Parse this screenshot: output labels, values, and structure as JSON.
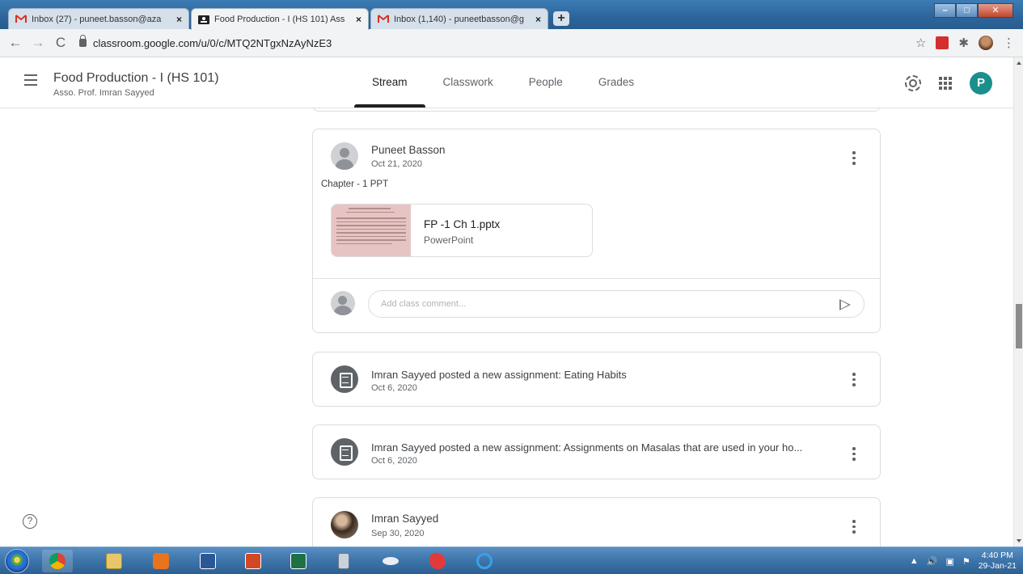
{
  "browser": {
    "tabs": [
      {
        "title": "Inbox (27) - puneet.basson@aza",
        "close": "×",
        "active": false,
        "favicon": "gmail-icon"
      },
      {
        "title": "Food Production - I (HS 101) Ass",
        "close": "×",
        "active": true,
        "favicon": "classroom-icon"
      },
      {
        "title": "Inbox (1,140) - puneetbasson@g",
        "close": "×",
        "active": false,
        "favicon": "gmail-icon"
      }
    ],
    "new_tab": "+",
    "url": "classroom.google.com/u/0/c/MTQ2NTgxNzAyNzE3"
  },
  "header": {
    "course_title": "Food Production - I (HS 101)",
    "course_subtitle": "Asso. Prof. Imran Sayyed",
    "tabs": [
      "Stream",
      "Classwork",
      "People",
      "Grades"
    ],
    "active_tab": "Stream",
    "user_initial": "P",
    "brand_color": "#1a8f8c"
  },
  "stream": {
    "post": {
      "author": "Puneet Basson",
      "date": "Oct 21, 2020",
      "body": "Chapter - 1 PPT",
      "attachment": {
        "name": "FP -1 Ch 1.pptx",
        "type": "PowerPoint"
      },
      "comment_placeholder": "Add class comment..."
    },
    "assignments": [
      {
        "title": "Imran Sayyed posted a new assignment: Eating Habits",
        "date": "Oct 6, 2020"
      },
      {
        "title": "Imran Sayyed posted a new assignment: Assignments on Masalas that are used in your ho...",
        "date": "Oct 6, 2020"
      }
    ],
    "last_post": {
      "author": "Imran Sayyed",
      "date": "Sep 30, 2020"
    }
  },
  "help": "?",
  "taskbar": {
    "clock_time": "4:40 PM",
    "clock_date": "29-Jan-21"
  }
}
